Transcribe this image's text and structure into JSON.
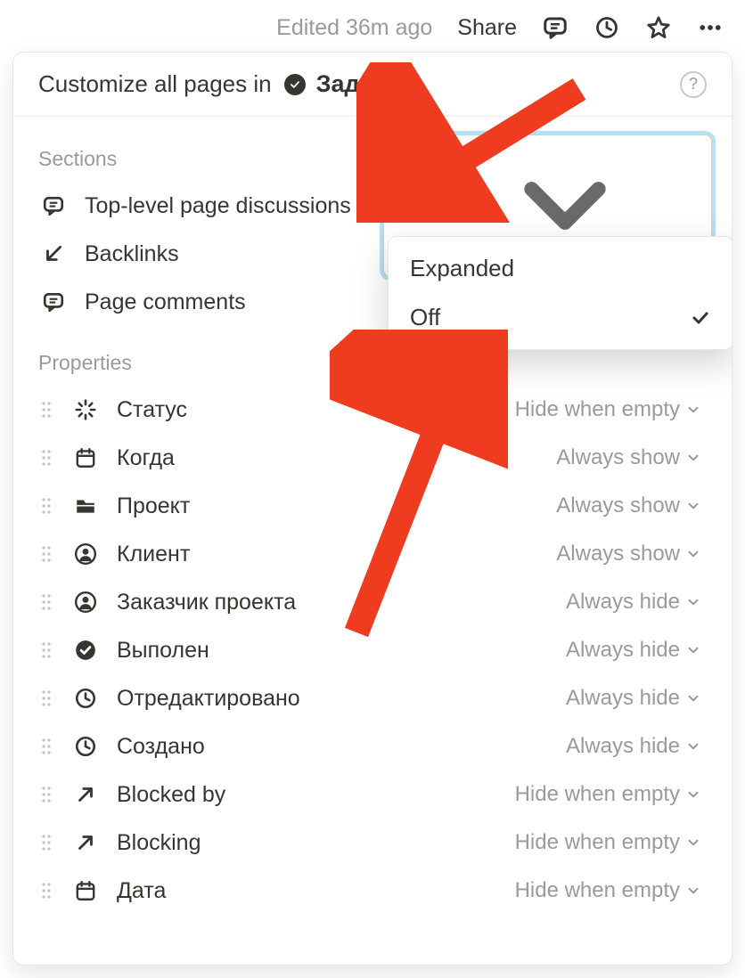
{
  "topbar": {
    "edited_text": "Edited 36m ago",
    "share_label": "Share"
  },
  "panel": {
    "header_prefix": "Customize all pages in",
    "page_title": "Задачи"
  },
  "sections_label": "Sections",
  "sections": [
    {
      "label": "Top-level page discussions",
      "value": "Off",
      "icon": "comment"
    },
    {
      "label": "Backlinks",
      "icon": "arrow-down-left"
    },
    {
      "label": "Page comments",
      "icon": "comment"
    }
  ],
  "dropdown": {
    "option_expanded": "Expanded",
    "option_off": "Off"
  },
  "properties_label": "Properties",
  "properties": [
    {
      "label": "Статус",
      "value": "Hide when empty",
      "icon": "spinner"
    },
    {
      "label": "Когда",
      "value": "Always show",
      "icon": "calendar"
    },
    {
      "label": "Проект",
      "value": "Always show",
      "icon": "folder"
    },
    {
      "label": "Клиент",
      "value": "Always show",
      "icon": "person"
    },
    {
      "label": "Заказчик проекта",
      "value": "Always hide",
      "icon": "person"
    },
    {
      "label": "Выполен",
      "value": "Always hide",
      "icon": "check-circle"
    },
    {
      "label": "Отредактировано",
      "value": "Always hide",
      "icon": "clock"
    },
    {
      "label": "Создано",
      "value": "Always hide",
      "icon": "clock"
    },
    {
      "label": "Blocked by",
      "value": "Hide when empty",
      "icon": "arrow-up-right"
    },
    {
      "label": "Blocking",
      "value": "Hide when empty",
      "icon": "arrow-up-right"
    },
    {
      "label": "Дата",
      "value": "Hide when empty",
      "icon": "calendar"
    }
  ]
}
